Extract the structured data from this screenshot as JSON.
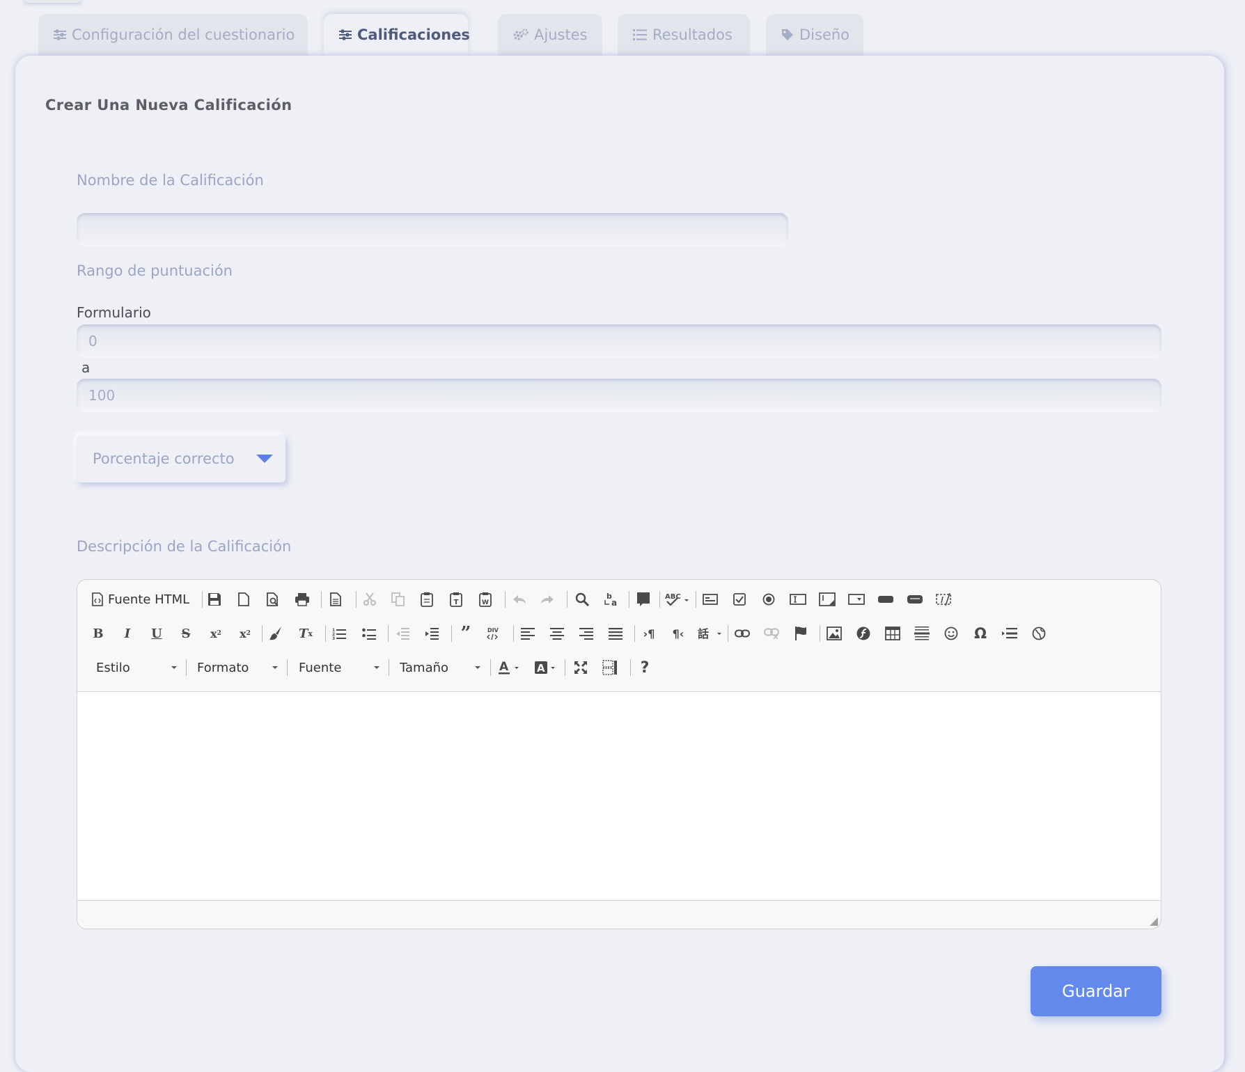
{
  "tabs": [
    {
      "label": "Configuración del cuestionario",
      "icon": "sliders-icon",
      "active": false
    },
    {
      "label": "Calificaciones",
      "icon": "sliders-icon",
      "active": true
    },
    {
      "label": "Ajustes",
      "icon": "gears-icon",
      "active": false
    },
    {
      "label": "Resultados",
      "icon": "list-icon",
      "active": false
    },
    {
      "label": "Diseño",
      "icon": "tag-icon",
      "active": false
    }
  ],
  "form": {
    "title": "Crear Una Nueva Calificación",
    "grade_name_label": "Nombre de la Calificación",
    "grade_name_value": "",
    "score_range_label": "Rango de puntuación",
    "from_label": "Formulario",
    "from_value": "0",
    "to_label": "a",
    "to_value": "100",
    "type_select_value": "Porcentaje correcto",
    "description_label": "Descripción de la Calificación",
    "save_label": "Guardar"
  },
  "editor": {
    "source_label": "Fuente HTML",
    "combos": {
      "style": "Estilo",
      "format": "Formato",
      "font": "Fuente",
      "size": "Tamaño"
    },
    "help_label": "?"
  },
  "colors": {
    "accent": "#6389ec",
    "background": "#eef0f5",
    "muted_text": "#9ba6c5",
    "active_tab_text": "#4f5b7c"
  }
}
